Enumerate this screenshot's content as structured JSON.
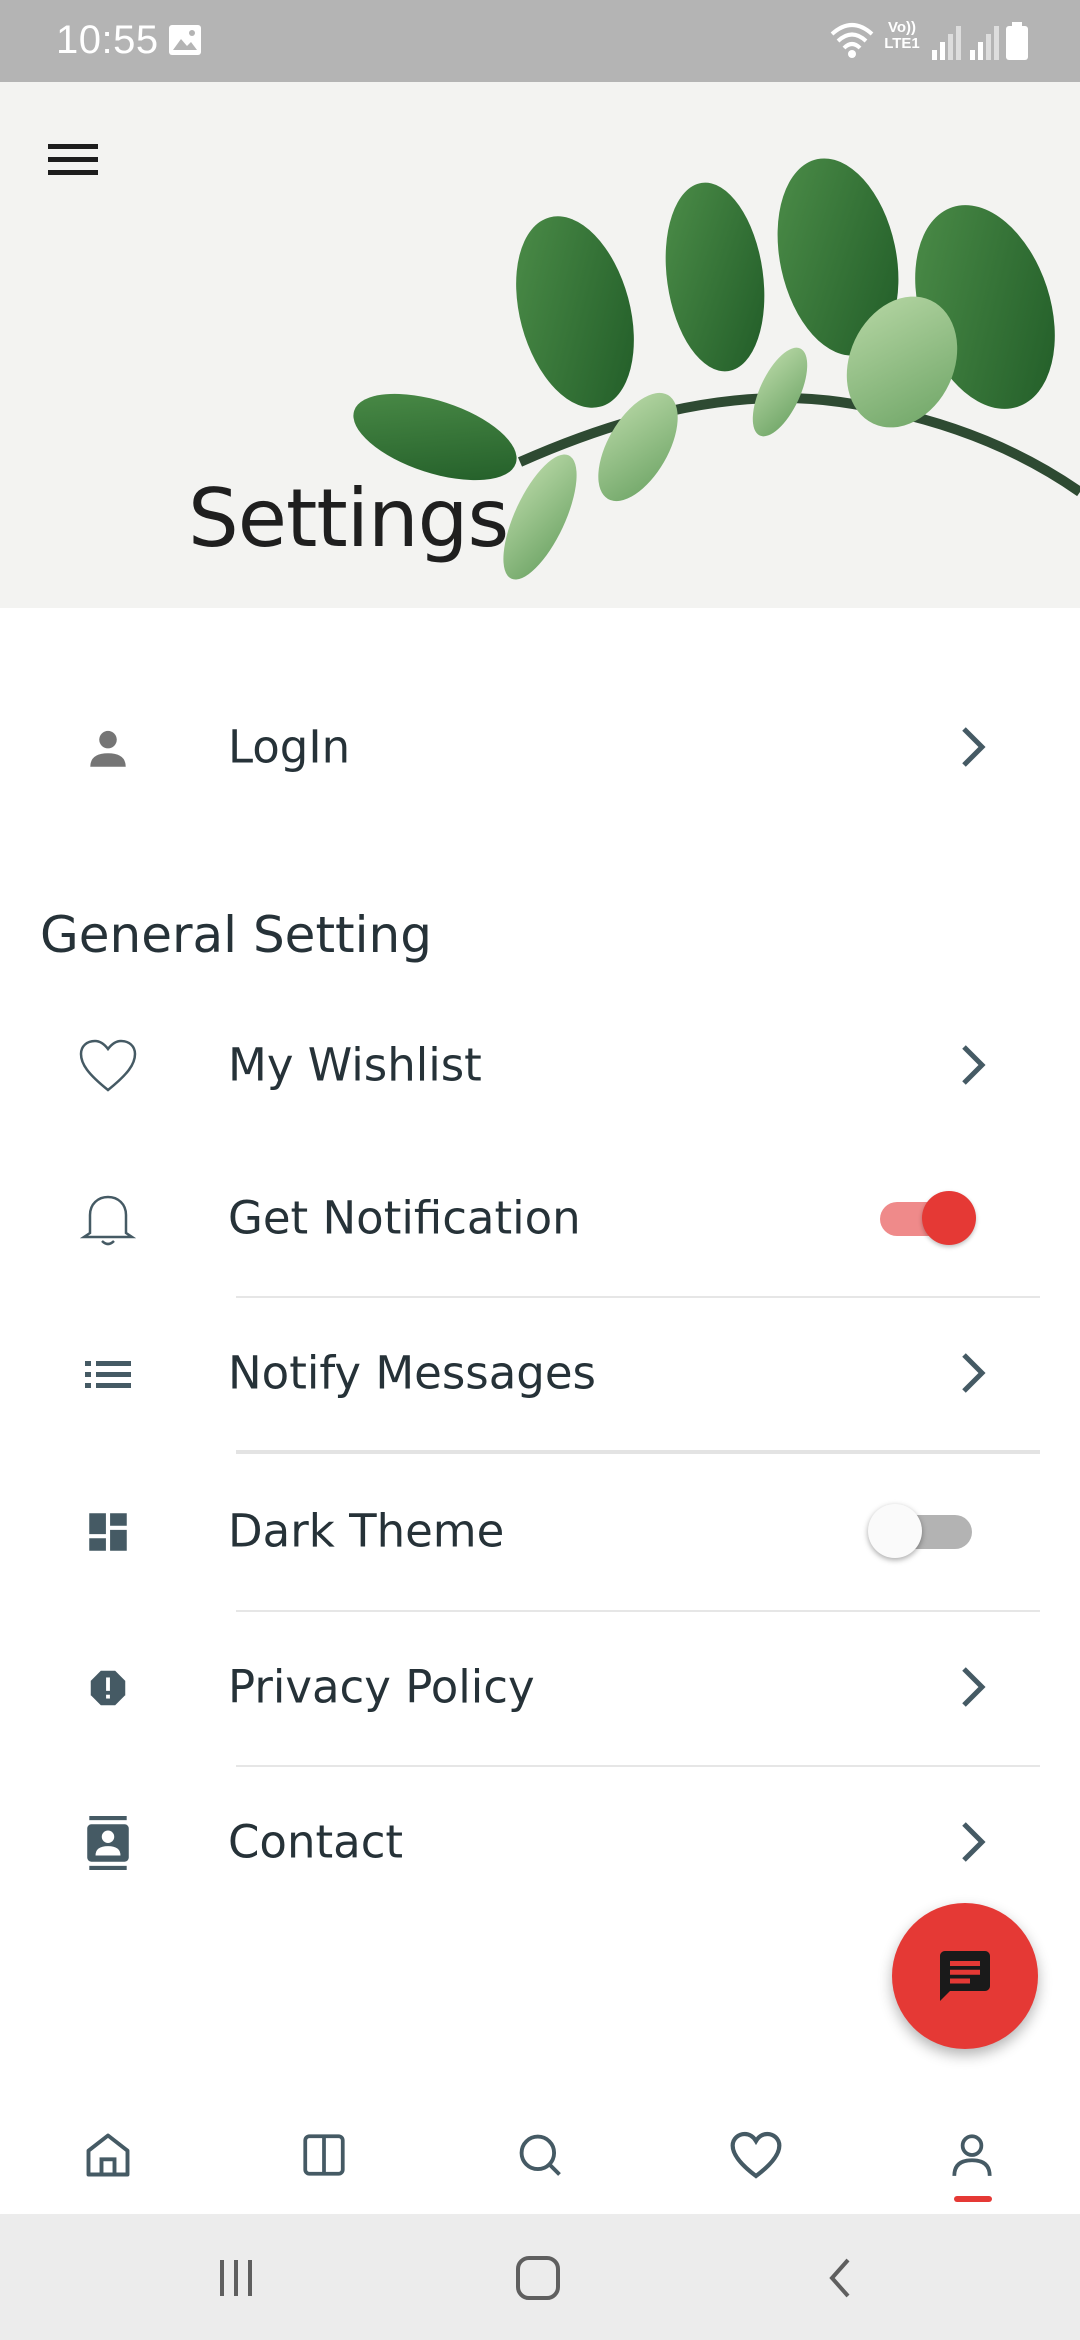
{
  "status_bar": {
    "time": "10:55",
    "icons": [
      "image-icon",
      "wifi-icon",
      "volte-icon",
      "signal-icon",
      "signal-icon",
      "battery-icon"
    ],
    "volte_text": "Vo))",
    "lte_text": "LTE1"
  },
  "header": {
    "title": "Settings",
    "menu_icon": "hamburger-menu-icon"
  },
  "login_row": {
    "label": "LogIn",
    "icon": "person-icon"
  },
  "general": {
    "section_title": "General Setting",
    "items": [
      {
        "label": "My Wishlist",
        "icon": "heart-outline-icon",
        "control": "chevron"
      },
      {
        "label": "Get Notification",
        "icon": "bell-icon",
        "control": "toggle",
        "value": true
      },
      {
        "label": "Notify Messages",
        "icon": "list-icon",
        "control": "chevron"
      },
      {
        "label": "Dark Theme",
        "icon": "dashboard-icon",
        "control": "toggle",
        "value": false
      },
      {
        "label": "Privacy Policy",
        "icon": "alert-octagon-icon",
        "control": "chevron"
      },
      {
        "label": "Contact",
        "icon": "contact-card-icon",
        "control": "chevron"
      }
    ]
  },
  "fab": {
    "icon": "chat-message-icon"
  },
  "bottom_nav": {
    "items": [
      "home-icon",
      "book-icon",
      "search-icon",
      "heart-icon",
      "profile-icon"
    ],
    "active": "profile-icon"
  },
  "system_nav": [
    "recent-apps-icon",
    "home-button-icon",
    "back-icon"
  ],
  "colors": {
    "accent": "#e53935",
    "icon": "#455a64",
    "text": "#263238",
    "status_bar": "#b4b4b4"
  }
}
